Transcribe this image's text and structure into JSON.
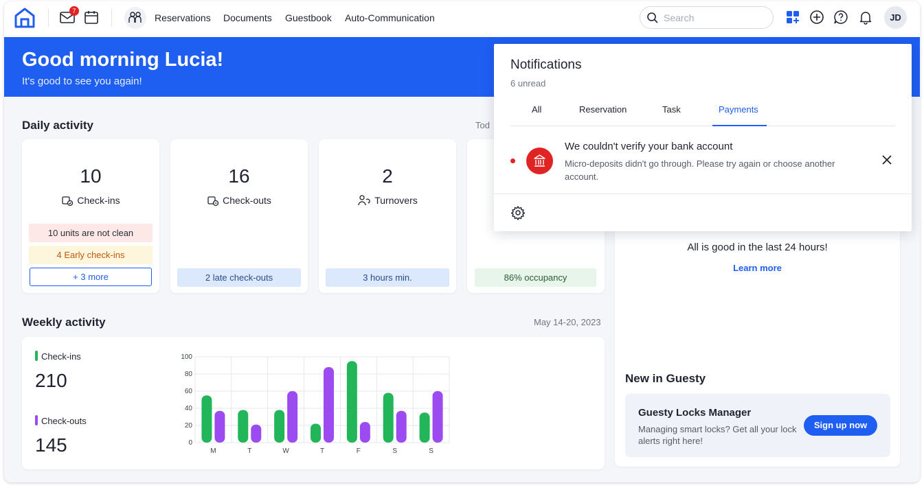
{
  "nav": {
    "links": [
      "Reservations",
      "Documents",
      "Guestbook",
      "Auto-Communication"
    ],
    "mail_badge": "7",
    "search_placeholder": "Search",
    "avatar_initials": "JD",
    "icons": [
      "home-logo-icon",
      "mail-icon",
      "calendar-icon",
      "people-icon",
      "search-icon",
      "apps-grid-icon",
      "plus-circle-icon",
      "help-chat-icon",
      "bell-icon"
    ]
  },
  "hero": {
    "greeting": "Good morning Lucia!",
    "subtitle": "It's good to see you again!"
  },
  "daily": {
    "title": "Daily activity",
    "date_label": "Tod",
    "cards": [
      {
        "value": "10",
        "label": "Check-ins",
        "pills": [
          "10 units are not clean",
          "4 Early check-ins"
        ],
        "more": "+ 3 more"
      },
      {
        "value": "16",
        "label": "Check-outs",
        "pills": [
          "2 late check-outs"
        ]
      },
      {
        "value": "2",
        "label": "Turnovers",
        "pills": [
          "3 hours min."
        ]
      },
      {
        "pills": [
          "86% occupancy"
        ]
      }
    ]
  },
  "weekly": {
    "title": "Weekly activity",
    "date_range": "May 14-20, 2023",
    "checkins_label": "Check-ins",
    "checkins_total": "210",
    "checkouts_label": "Check-outs",
    "checkouts_total": "145"
  },
  "chart_data": {
    "type": "bar",
    "categories": [
      "M",
      "T",
      "W",
      "T",
      "F",
      "S",
      "S"
    ],
    "series": [
      {
        "name": "Check-ins",
        "color": "#22b559",
        "values": [
          55,
          38,
          38,
          22,
          95,
          58,
          35
        ]
      },
      {
        "name": "Check-outs",
        "color": "#9b4bf0",
        "values": [
          37,
          21,
          60,
          88,
          24,
          37,
          60
        ]
      }
    ],
    "ylim": [
      0,
      100
    ],
    "yticks": [
      "0",
      "20",
      "40",
      "60",
      "80",
      "100"
    ],
    "grid": true
  },
  "right_panel": {
    "all_good": "All is good in the last 24 hours!",
    "learn_more": "Learn more",
    "new_title": "New in Guesty",
    "promo_title": "Guesty Locks Manager",
    "promo_text": "Managing smart locks? Get all your lock alerts right here!",
    "promo_button": "Sign up now"
  },
  "notifications": {
    "title": "Notifications",
    "unread": "6 unread",
    "tabs": [
      "All",
      "Reservation",
      "Task",
      "Payments"
    ],
    "active_tab": "Payments",
    "item": {
      "heading": "We couldn't verify your bank account",
      "body": "Micro-deposits didn't go through. Please try again or choose another account.",
      "icon": "bank-icon"
    }
  },
  "colors": {
    "primary": "#1e5ef1",
    "checkins": "#22b559",
    "checkouts": "#9b4bf0",
    "alert": "#e02424"
  }
}
